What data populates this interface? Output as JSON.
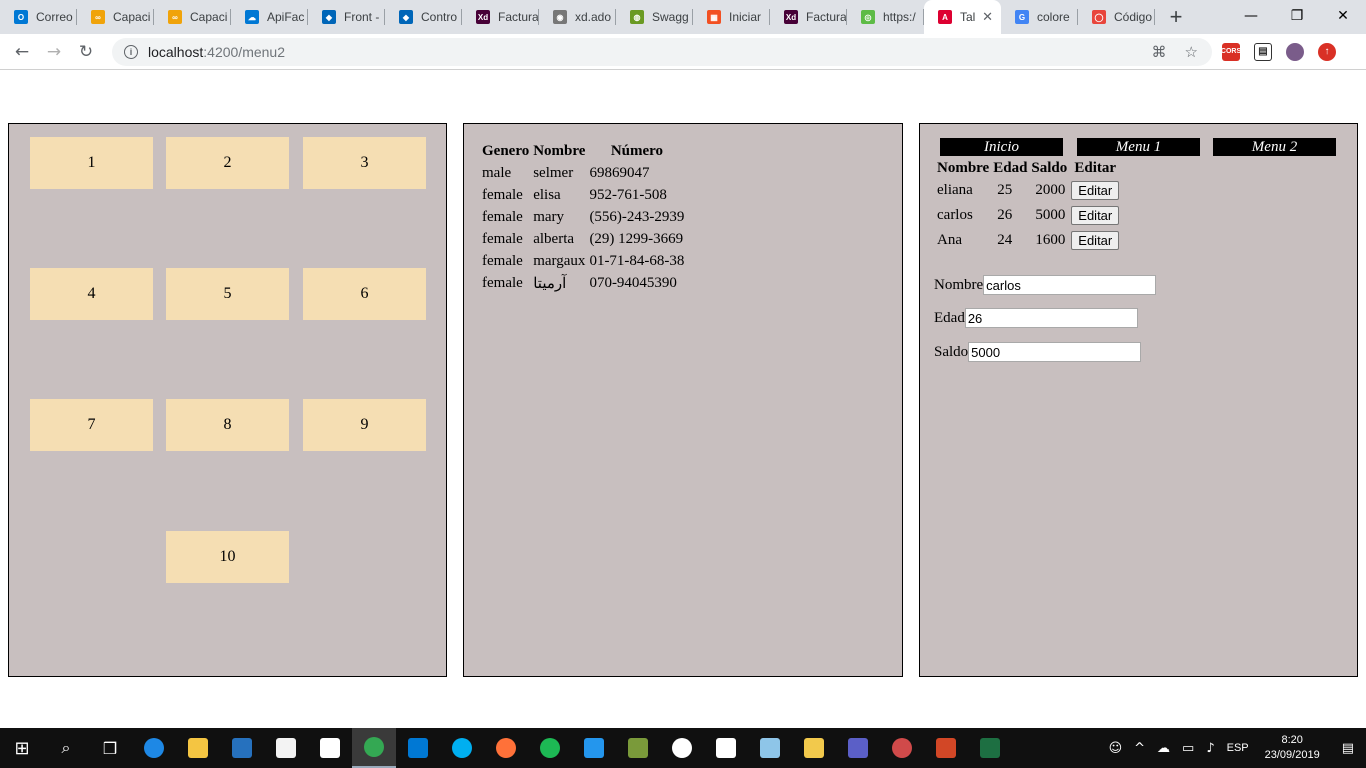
{
  "browser": {
    "tabs": [
      {
        "label": "Correo",
        "color": "#0078d4",
        "glyph": "O"
      },
      {
        "label": "Capaci",
        "color": "#f0a30a",
        "glyph": "∞"
      },
      {
        "label": "Capaci",
        "color": "#f0a30a",
        "glyph": "∞"
      },
      {
        "label": "ApiFac",
        "color": "#0078d4",
        "glyph": "☁"
      },
      {
        "label": "Front -",
        "color": "#0066b8",
        "glyph": "◆"
      },
      {
        "label": "Contro",
        "color": "#0066b8",
        "glyph": "◆"
      },
      {
        "label": "Factura",
        "color": "#470137",
        "glyph": "Xd"
      },
      {
        "label": "xd.ado",
        "color": "#777777",
        "glyph": "◉"
      },
      {
        "label": "Swagg",
        "color": "#6a9a23",
        "glyph": "◍"
      },
      {
        "label": "Iniciar",
        "color": "#f25022",
        "glyph": "▦"
      },
      {
        "label": "Factura",
        "color": "#470137",
        "glyph": "Xd"
      },
      {
        "label": "https:/",
        "color": "#5dbb46",
        "glyph": "◎"
      },
      {
        "label": "Tal",
        "color": "#dd0031",
        "glyph": "A",
        "active": true
      },
      {
        "label": "colore",
        "color": "#4285f4",
        "glyph": "G"
      },
      {
        "label": "Código",
        "color": "#e8453c",
        "glyph": "◯"
      }
    ],
    "url_host": "localhost",
    "url_path": ":4200/menu2",
    "ext_cors": "CORS"
  },
  "panel1": {
    "boxes": [
      "1",
      "2",
      "3",
      "4",
      "5",
      "6",
      "7",
      "8",
      "9",
      "10"
    ]
  },
  "panel2": {
    "headers": [
      "Genero",
      "Nombre",
      "Número"
    ],
    "rows": [
      [
        "male",
        "selmer",
        "69869047"
      ],
      [
        "female",
        "elisa",
        "952-761-508"
      ],
      [
        "female",
        "mary",
        "(556)-243-2939"
      ],
      [
        "female",
        "alberta",
        "(29) 1299-3669"
      ],
      [
        "female",
        "margaux",
        "01-71-84-68-38"
      ],
      [
        "female",
        "آرمیتا",
        "070-94045390"
      ]
    ]
  },
  "panel3": {
    "menu": [
      "Inicio",
      "Menu 1",
      "Menu 2"
    ],
    "headers": [
      "Nombre",
      "Edad",
      "Saldo",
      "Editar"
    ],
    "rows": [
      {
        "nombre": "eliana",
        "edad": "25",
        "saldo": "2000",
        "btn": "Editar"
      },
      {
        "nombre": "carlos",
        "edad": "26",
        "saldo": "5000",
        "btn": "Editar"
      },
      {
        "nombre": "Ana",
        "edad": "24",
        "saldo": "1600",
        "btn": "Editar"
      }
    ],
    "form": {
      "nombre_label": "Nombre",
      "nombre_value": "carlos",
      "edad_label": "Edad",
      "edad_value": "26",
      "saldo_label": "Saldo",
      "saldo_value": "5000"
    }
  },
  "taskbar": {
    "lang": "ESP",
    "time": "8:20",
    "date": "23/09/2019"
  }
}
